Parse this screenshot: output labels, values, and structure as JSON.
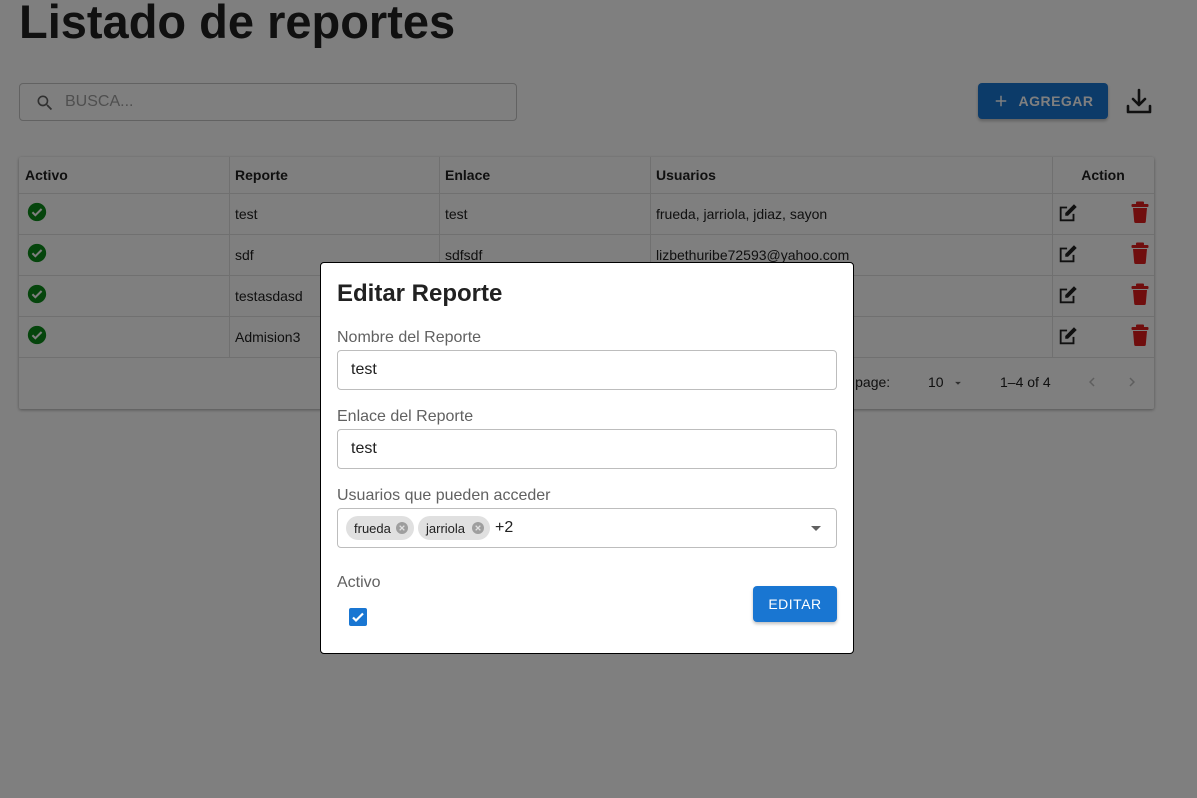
{
  "page": {
    "title": "Listado de reportes"
  },
  "search": {
    "placeholder": "BUSCA..."
  },
  "toolbar": {
    "add_label": "AGREGAR"
  },
  "table": {
    "columns": [
      "Activo",
      "Reporte",
      "Enlace",
      "Usuarios",
      "Action"
    ],
    "rows": [
      {
        "active": true,
        "reporte": "test",
        "enlace": "test",
        "usuarios": "frueda, jarriola, jdiaz, sayon"
      },
      {
        "active": true,
        "reporte": "sdf",
        "enlace": "sdfsdf",
        "usuarios": "lizbethuribe72593@yahoo.com"
      },
      {
        "active": true,
        "reporte": "testasdasd",
        "enlace": "",
        "usuarios": ""
      },
      {
        "active": true,
        "reporte": "Admision3",
        "enlace": "",
        "usuarios": ""
      }
    ],
    "footer": {
      "rows_per_page_label": "per page:",
      "rows_per_page_value": "10",
      "range": "1–4 of 4"
    }
  },
  "modal": {
    "title": "Editar Reporte",
    "nombre_label": "Nombre del Reporte",
    "nombre_value": "test",
    "enlace_label": "Enlace del Reporte",
    "enlace_value": "test",
    "usuarios_label": "Usuarios que pueden acceder",
    "chips": [
      "frueda",
      "jarriola"
    ],
    "more_count": "+2",
    "activo_label": "Activo",
    "activo_checked": true,
    "submit_label": "EDITAR"
  },
  "colors": {
    "primary": "#1976d2",
    "success": "#0a8a18",
    "danger": "#e11d1d",
    "backdrop": "rgba(0,0,0,0.5)"
  }
}
